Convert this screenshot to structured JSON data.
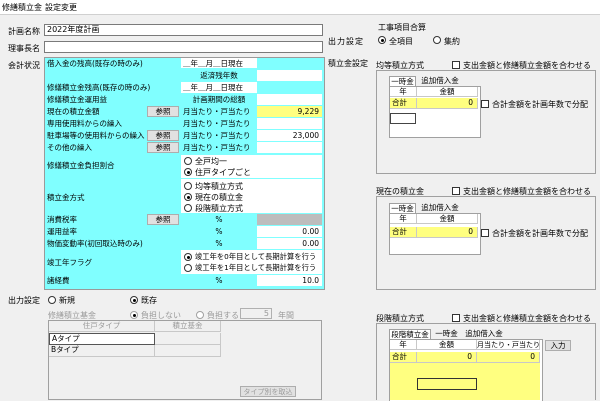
{
  "window": {
    "title": "修繕積立金",
    "menu": "設定変更"
  },
  "header": {
    "plan_name_label": "計画名称",
    "plan_name_value": "2022年度計画",
    "chair_label": "理事長名",
    "chair_value": "",
    "output_settings_label": "出力設定",
    "work_item_total_label": "工事項目合算",
    "all_items_label": "全項目",
    "aggregate_label": "集約"
  },
  "accounting": {
    "section_label": "会計状況",
    "rows": [
      {
        "label": "借入金の残高(既存の時のみ)",
        "mid": "＿年＿月＿日現在",
        "value": ""
      },
      {
        "label": "",
        "mid": "返済残年数",
        "value": ""
      },
      {
        "label": "修繕積立金残高(既存の時のみ)",
        "mid": "＿年＿月＿日現在",
        "value": ""
      },
      {
        "label": "修繕積立金運用益",
        "mid": "計画期間の総額",
        "value": ""
      },
      {
        "label": "現在の積立金額",
        "button": "参照",
        "mid": "月当たり・戸当たり",
        "value": "9,229"
      },
      {
        "label": "専用使用料からの繰入",
        "mid": "月当たり・戸当たり",
        "value": ""
      },
      {
        "label": "駐車場等の使用料からの繰入",
        "button": "参照",
        "mid": "月当たり・戸当たり",
        "value": "23,000"
      },
      {
        "label": "その他の繰入",
        "button": "参照",
        "mid": "月当たり・戸当たり",
        "value": ""
      }
    ],
    "burden_label": "修繕積立金負担割合",
    "burden_options": [
      "全戸均一",
      "住戸タイプごと"
    ],
    "method_label": "積立金方式",
    "method_options": [
      "均等積立方式",
      "現在の積立金",
      "段階積立方式"
    ],
    "tax_label": "消費税率",
    "tax_button": "参照",
    "tax_unit": "%",
    "yield_label": "運用益率",
    "yield_unit": "%",
    "yield_value": "0.00",
    "inflation_label": "物価変動率(初回取込時のみ)",
    "inflation_unit": "%",
    "inflation_value": "0.00",
    "completion_label": "竣工年フラグ",
    "completion_options": [
      "竣工年を0年目として長期計算を行う",
      "竣工年を1年目として長期計算を行う"
    ],
    "misc_label": "諸経費",
    "misc_unit": "%",
    "misc_value": "10.0"
  },
  "output": {
    "section_label": "出力設定",
    "new_label": "新規",
    "existing_label": "既存",
    "fund_label": "修繕積立基金",
    "no_burden_label": "負担しない",
    "burden_label": "負担する",
    "years_value": "5",
    "years_unit": "年間",
    "col_type": "住戸タイプ",
    "col_fund": "積立基金",
    "types": [
      "Aタイプ",
      "Bタイプ"
    ],
    "import_button": "タイプ別を取込"
  },
  "right": {
    "section_label": "積立金設定",
    "equal": {
      "title": "均等積立方式",
      "match_label": "支出金額と修繕積立金額を合わせる",
      "tab1": "一時金",
      "tab2": "追加借入金",
      "col_year": "年",
      "col_amount": "金額",
      "total_label": "合計",
      "total_value": "0",
      "spread_label": "合計金額を計画年数で分配"
    },
    "current": {
      "title": "現在の積立金",
      "match_label": "支出金額と修繕積立金額を合わせる",
      "tab1": "一時金",
      "tab2": "追加借入金",
      "col_year": "年",
      "col_amount": "金額",
      "total_label": "合計",
      "total_value": "0",
      "spread_label": "合計金額を計画年数で分配"
    },
    "staged": {
      "title": "段階積立方式",
      "match_label": "支出金額と修繕積立金額を合わせる",
      "tab1": "段階積立金",
      "tab2": "一時金",
      "tab3": "追加借入金",
      "col_year": "年",
      "col_amount": "金額",
      "col_monthly": "月当たり・戸当たり",
      "input_button": "入力",
      "total_label": "合計",
      "total_value": "0",
      "total_monthly": "0"
    }
  }
}
